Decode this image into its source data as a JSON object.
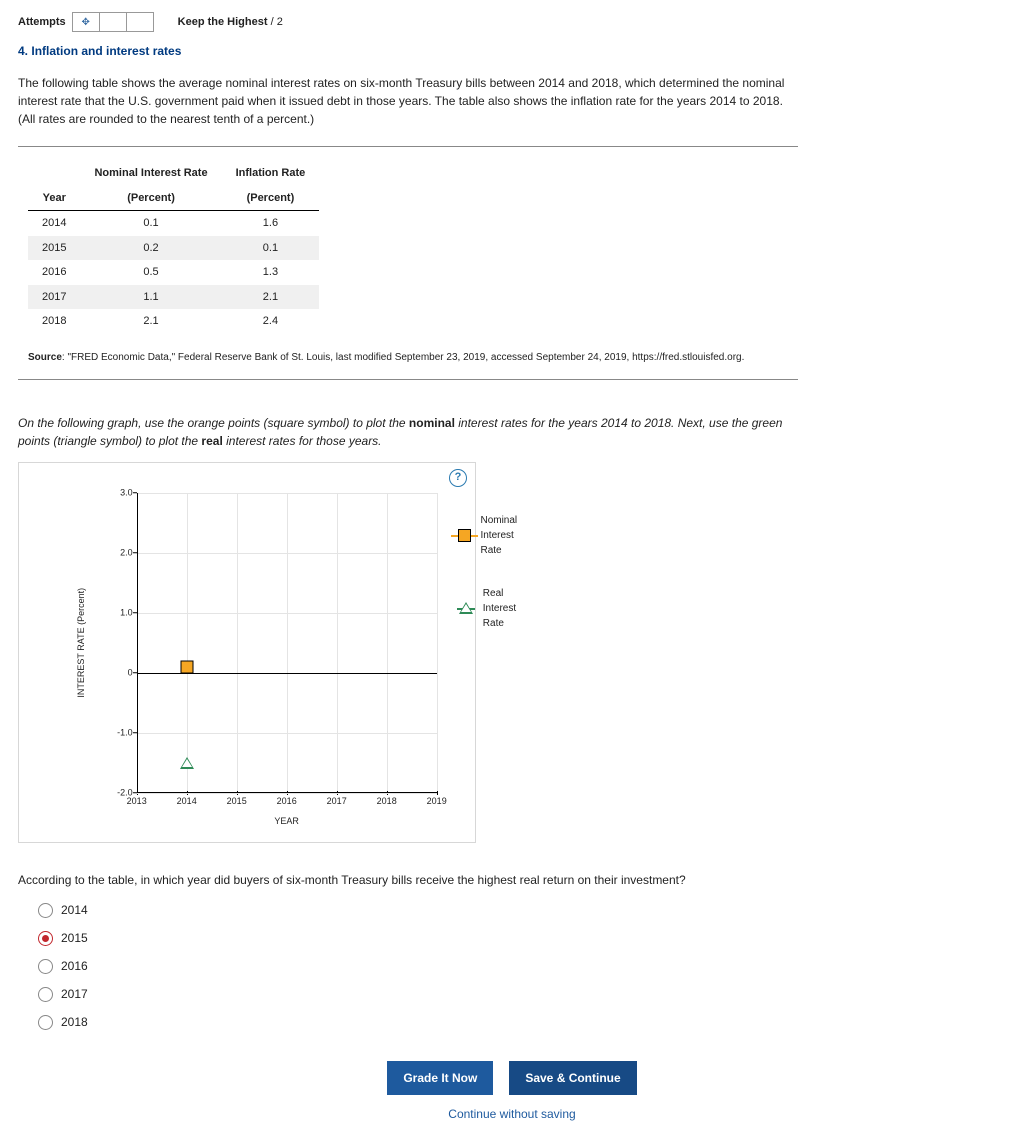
{
  "top": {
    "attempts_label": "Attempts",
    "move_icon": "✥",
    "keep_label": "Keep the Highest",
    "keep_of": "/ 2"
  },
  "section": {
    "num": "4.",
    "title": "Inflation and interest rates"
  },
  "intro": "The following table shows the average nominal interest rates on six-month Treasury bills between 2014 and 2018, which determined the nominal interest rate that the U.S. government paid when it issued debt in those years. The table also shows the inflation rate for the years 2014 to 2018. (All rates are rounded to the nearest tenth of a percent.)",
  "table": {
    "h_year": "Year",
    "h_nom": "Nominal Interest Rate",
    "h_nom_unit": "(Percent)",
    "h_inf": "Inflation Rate",
    "h_inf_unit": "(Percent)",
    "rows": [
      {
        "year": "2014",
        "nom": "0.1",
        "inf": "1.6"
      },
      {
        "year": "2015",
        "nom": "0.2",
        "inf": "0.1"
      },
      {
        "year": "2016",
        "nom": "0.5",
        "inf": "1.3"
      },
      {
        "year": "2017",
        "nom": "1.1",
        "inf": "2.1"
      },
      {
        "year": "2018",
        "nom": "2.1",
        "inf": "2.4"
      }
    ]
  },
  "source_label": "Source",
  "source_text": ": \"FRED Economic Data,\" Federal Reserve Bank of St. Louis, last modified September 23, 2019, accessed September 24, 2019, https://fred.stlouisfed.org.",
  "instruct_pre": "On the following graph, use the orange points (square symbol) to plot the ",
  "instruct_b1": "nominal",
  "instruct_mid": " interest rates for the years 2014 to 2018. Next, use the green points (triangle symbol) to plot the ",
  "instruct_b2": "real",
  "instruct_post": " interest rates for those years.",
  "chart_data": {
    "type": "scatter",
    "xlabel": "YEAR",
    "ylabel": "INTEREST RATE (Percent)",
    "xlim": [
      2013,
      2019
    ],
    "ylim": [
      -2.0,
      3.0
    ],
    "xticks": [
      "2013",
      "2014",
      "2015",
      "2016",
      "2017",
      "2018",
      "2019"
    ],
    "yticks": [
      "-2.0",
      "-1.0",
      "0",
      "1.0",
      "2.0",
      "3.0"
    ],
    "series": [
      {
        "name": "Nominal Interest Rate",
        "symbol": "square",
        "color": "#f5a623",
        "x": [
          2014
        ],
        "y": [
          0.1
        ]
      },
      {
        "name": "Real Interest Rate",
        "symbol": "triangle",
        "color": "#2e8b57",
        "x": [
          2014
        ],
        "y": [
          -1.5
        ]
      }
    ],
    "legend": [
      {
        "label": "Nominal Interest Rate",
        "symbol": "square"
      },
      {
        "label": "Real Interest Rate",
        "symbol": "triangle"
      }
    ]
  },
  "question": "According to the table, in which year did buyers of six-month Treasury bills receive the highest real return on their investment?",
  "options": [
    {
      "label": "2014",
      "selected": false
    },
    {
      "label": "2015",
      "selected": true
    },
    {
      "label": "2016",
      "selected": false
    },
    {
      "label": "2017",
      "selected": false
    },
    {
      "label": "2018",
      "selected": false
    }
  ],
  "buttons": {
    "grade": "Grade It Now",
    "save": "Save & Continue",
    "cws": "Continue without saving"
  },
  "help": "?"
}
